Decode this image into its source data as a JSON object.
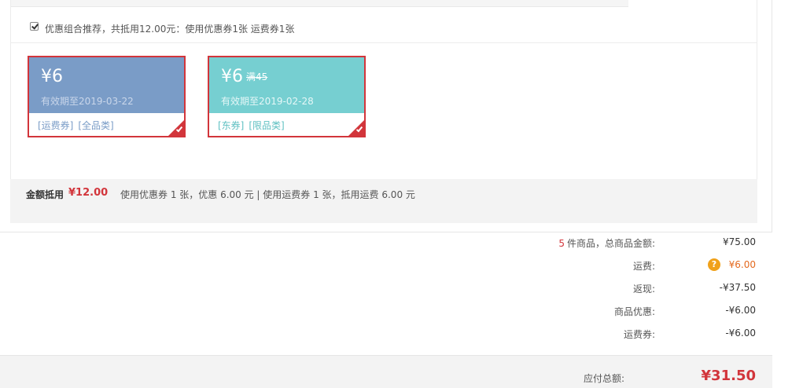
{
  "combo": {
    "checked": true,
    "text": "优惠组合推荐，共抵用12.00元：使用优惠券1张 运费券1张"
  },
  "coupons": [
    {
      "amount": "¥6",
      "condition": "",
      "validity": "有效期至2019-03-22",
      "tag1": "[运费券]",
      "tag2": "[全品类]",
      "selected": true,
      "color": "#7a9cc7"
    },
    {
      "amount": "¥6",
      "condition": "满45",
      "validity": "有效期至2019-02-28",
      "tag1": "[东券]",
      "tag2": "[限品类]",
      "selected": true,
      "color": "#76cfd1"
    }
  ],
  "summary": {
    "label": "金额抵用",
    "amount": "¥12.00",
    "detail": "使用优惠券 1 张，优惠 6.00 元  | 使用运费券 1 张，抵用运费 6.00 元"
  },
  "totals": {
    "goods_count": "5",
    "goods_label": "件商品，总商品金额:",
    "goods_value": "¥75.00",
    "shipping_label": "运费:",
    "shipping_value": "¥6.00",
    "cashback_label": "返现:",
    "cashback_value": "-¥37.50",
    "discount_label": "商品优惠:",
    "discount_value": "-¥6.00",
    "shipping_coupon_label": "运费券:",
    "shipping_coupon_value": "-¥6.00",
    "help_icon_char": "?"
  },
  "payable": {
    "label": "应付总额:",
    "value": "¥31.50"
  },
  "colors": {
    "accent_red": "#d2353b",
    "orange": "#e4691e",
    "help_icon": "#f0a11a"
  }
}
